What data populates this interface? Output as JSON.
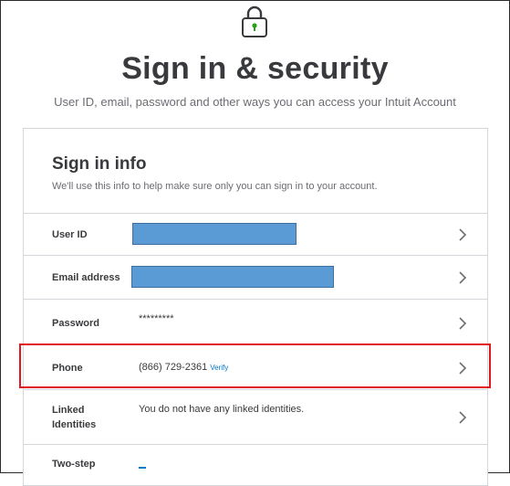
{
  "header": {
    "title": "Sign in & security",
    "subtitle": "User ID, email, password and other ways you can access your Intuit Account"
  },
  "card": {
    "title": "Sign in info",
    "description": "We'll use this info to help make sure only you can sign in to your account.",
    "rows": [
      {
        "label": "User ID",
        "value": "",
        "redacted": true
      },
      {
        "label": "Email address",
        "value": "",
        "redacted": true
      },
      {
        "label": "Password",
        "value": "*********"
      },
      {
        "label": "Phone",
        "value": "(866) 729-2361",
        "link": "Verify"
      },
      {
        "label_line1": "Linked",
        "label_line2": "Identities",
        "value": "You do not have any linked identities."
      },
      {
        "label": "Two-step"
      }
    ]
  },
  "icons": {
    "lock": "lock-icon",
    "chevron": "chevron-right-icon"
  },
  "colors": {
    "redaction": "#5b9bd5",
    "highlight": "#e0151f",
    "link": "#0077c5"
  }
}
